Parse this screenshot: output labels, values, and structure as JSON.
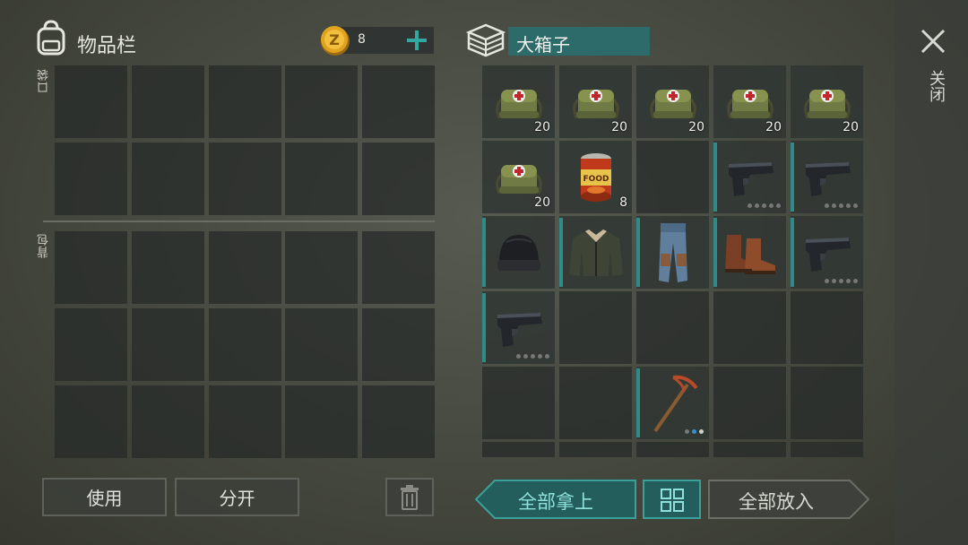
{
  "inventory": {
    "title": "物品栏",
    "coins": "8",
    "pocket_label": "口袋",
    "backpack_label": "背包"
  },
  "container": {
    "title": "大箱子",
    "items": [
      {
        "name": "medical-bag",
        "qty": "20"
      },
      {
        "name": "medical-bag",
        "qty": "20"
      },
      {
        "name": "medical-bag",
        "qty": "20"
      },
      {
        "name": "medical-bag",
        "qty": "20"
      },
      {
        "name": "medical-bag",
        "qty": "20"
      },
      {
        "name": "medical-bag",
        "qty": "20"
      },
      {
        "name": "canned-food",
        "qty": "8"
      },
      {
        "name": "pistol",
        "durability": 4
      },
      {
        "name": "pistol",
        "durability": 4
      },
      {
        "name": "beanie-hat"
      },
      {
        "name": "jacket"
      },
      {
        "name": "jeans"
      },
      {
        "name": "boots"
      },
      {
        "name": "pistol",
        "durability": 4
      },
      {
        "name": "pistol",
        "durability": 4
      },
      {
        "name": "pickaxe",
        "durability": 2
      }
    ]
  },
  "buttons": {
    "use": "使用",
    "split": "分开",
    "take_all": "全部拿上",
    "put_all": "全部放入",
    "close": "关闭"
  },
  "colors": {
    "accent": "#2f8b87",
    "coin": "#e0a21f",
    "title_field": "#2c6b6a"
  }
}
